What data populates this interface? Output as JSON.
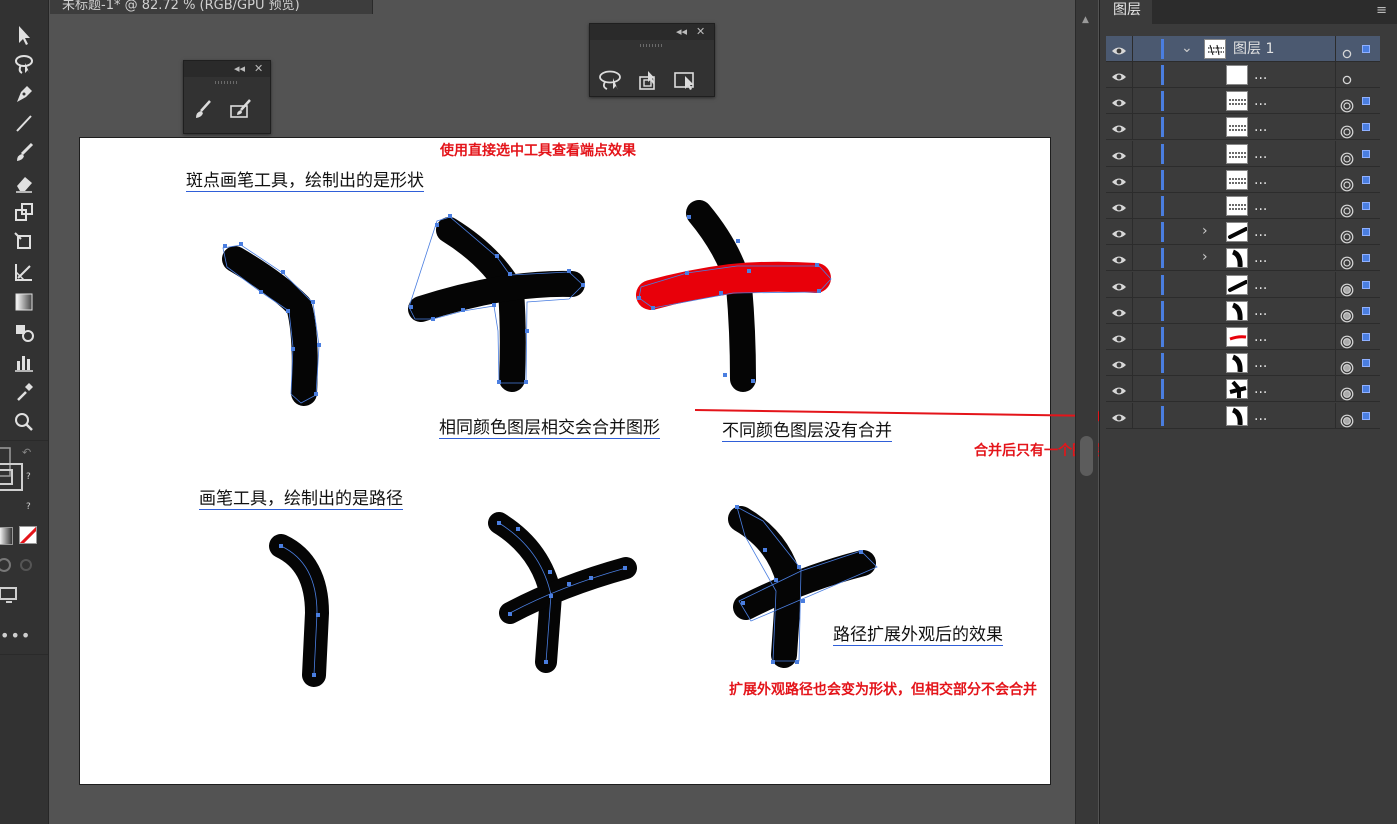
{
  "document_tab": {
    "title": "未标题-1* @ 82.72 % (RGB/GPU 预览)"
  },
  "toolbar": {
    "tools": [
      {
        "icon": "selection-arrow-icon",
        "label": "选择工具"
      },
      {
        "icon": "lasso-icon",
        "label": "套索工具"
      },
      {
        "icon": "pen-icon",
        "label": "钢笔工具"
      },
      {
        "icon": "line-segment-icon",
        "label": "直线段工具"
      },
      {
        "icon": "paintbrush-icon",
        "label": "画笔工具"
      },
      {
        "icon": "eraser-icon",
        "label": "橡皮擦工具"
      },
      {
        "icon": "scale-icon",
        "label": "比例缩放工具"
      },
      {
        "icon": "free-transform-icon",
        "label": "自由变换工具"
      },
      {
        "icon": "shape-builder-icon",
        "label": "形状生成器工具"
      },
      {
        "icon": "gradient-icon",
        "label": "渐变工具"
      },
      {
        "icon": "blend-icon",
        "label": "混合工具"
      },
      {
        "icon": "column-graph-icon",
        "label": "柱形图工具"
      },
      {
        "icon": "eyedropper-icon",
        "label": "吸管工具"
      },
      {
        "icon": "zoom-icon",
        "label": "缩放工具"
      }
    ]
  },
  "float_panel_brush": {
    "collapse": "◂◂",
    "close": "✕",
    "icons": [
      "paintbrush-icon",
      "blob-brush-icon"
    ]
  },
  "float_panel_select": {
    "collapse": "◂◂",
    "close": "✕",
    "icons": [
      "lasso-select-icon",
      "group-select-icon",
      "direct-select-icon"
    ]
  },
  "artboard": {
    "heading_red": "使用直接选中工具查看端点效果",
    "label_blob_brush": "斑点画笔工具，绘制出的是形状",
    "label_same_color": "相同颜色图层相交会合并图形",
    "label_diff_color": "不同颜色图层没有合并",
    "label_paintbrush": "画笔工具，绘制出的是路径",
    "label_expand": "路径扩展外观后的效果",
    "note_expand_red": "扩展外观路径也会变为形状，但相交部分不会合并"
  },
  "annotation": {
    "text": "合并后只有一个图层",
    "color": "#e4141a"
  },
  "layers_panel": {
    "tab_label": "图层",
    "menu_icon": "≡",
    "parent": {
      "name": "图层 1",
      "thumbnail": "layer-1-thumbnail"
    },
    "items": [
      {
        "name": "...",
        "thumbnail": "blank",
        "expandable": false,
        "appearance": "hollow"
      },
      {
        "name": "...",
        "thumbnail": "horizontal-scribble",
        "expandable": false,
        "appearance": "filled"
      },
      {
        "name": "...",
        "thumbnail": "horizontal-scribble",
        "expandable": false,
        "appearance": "filled"
      },
      {
        "name": "...",
        "thumbnail": "horizontal-scribble",
        "expandable": false,
        "appearance": "filled"
      },
      {
        "name": "...",
        "thumbnail": "horizontal-scribble",
        "expandable": false,
        "appearance": "filled"
      },
      {
        "name": "...",
        "thumbnail": "horizontal-scribble",
        "expandable": false,
        "appearance": "filled"
      },
      {
        "name": "...",
        "thumbnail": "diagonal-stroke",
        "expandable": true,
        "appearance": "filled"
      },
      {
        "name": "...",
        "thumbnail": "bent-stroke",
        "expandable": true,
        "appearance": "filled"
      },
      {
        "name": "...",
        "thumbnail": "diagonal-stroke",
        "expandable": false,
        "appearance": "filled-active"
      },
      {
        "name": "...",
        "thumbnail": "bent-stroke",
        "expandable": false,
        "appearance": "filled-active"
      },
      {
        "name": "...",
        "thumbnail": "red-stroke",
        "expandable": false,
        "appearance": "filled-active"
      },
      {
        "name": "...",
        "thumbnail": "bent-stroke",
        "expandable": false,
        "appearance": "filled-active"
      },
      {
        "name": "...",
        "thumbnail": "cross-shape",
        "expandable": false,
        "appearance": "filled-active"
      },
      {
        "name": "...",
        "thumbnail": "bent-stroke",
        "expandable": false,
        "appearance": "filled-active"
      }
    ]
  },
  "colors": {
    "accent": "#4a7ee0",
    "red": "#e4141a",
    "ink": "#050505"
  }
}
